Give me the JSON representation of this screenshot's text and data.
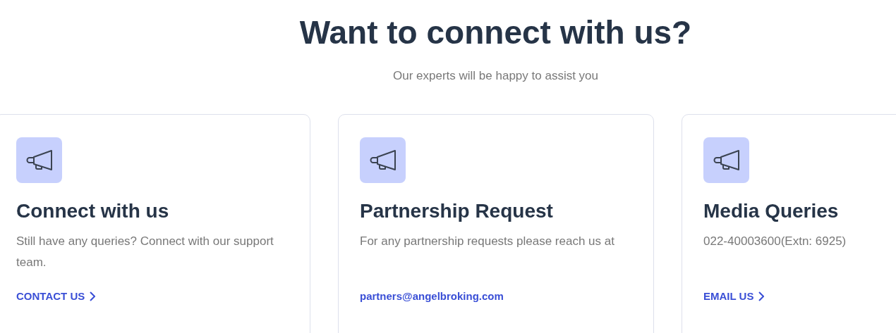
{
  "heading": "Want to connect with us?",
  "subheading": "Our experts will be happy to assist you",
  "cards": [
    {
      "title": "Connect with us",
      "text": "Still have any queries? Connect with our support team.",
      "link": {
        "kind": "arrow",
        "label": "CONTACT US"
      }
    },
    {
      "title": "Partnership Request",
      "text": "For any partnership requests please reach us at",
      "link": {
        "kind": "email",
        "label": "partners@angelbroking.com"
      }
    },
    {
      "title": "Media Queries",
      "text": "022-40003600(Extn: 6925)",
      "link": {
        "kind": "arrow",
        "label": "EMAIL US"
      }
    }
  ]
}
